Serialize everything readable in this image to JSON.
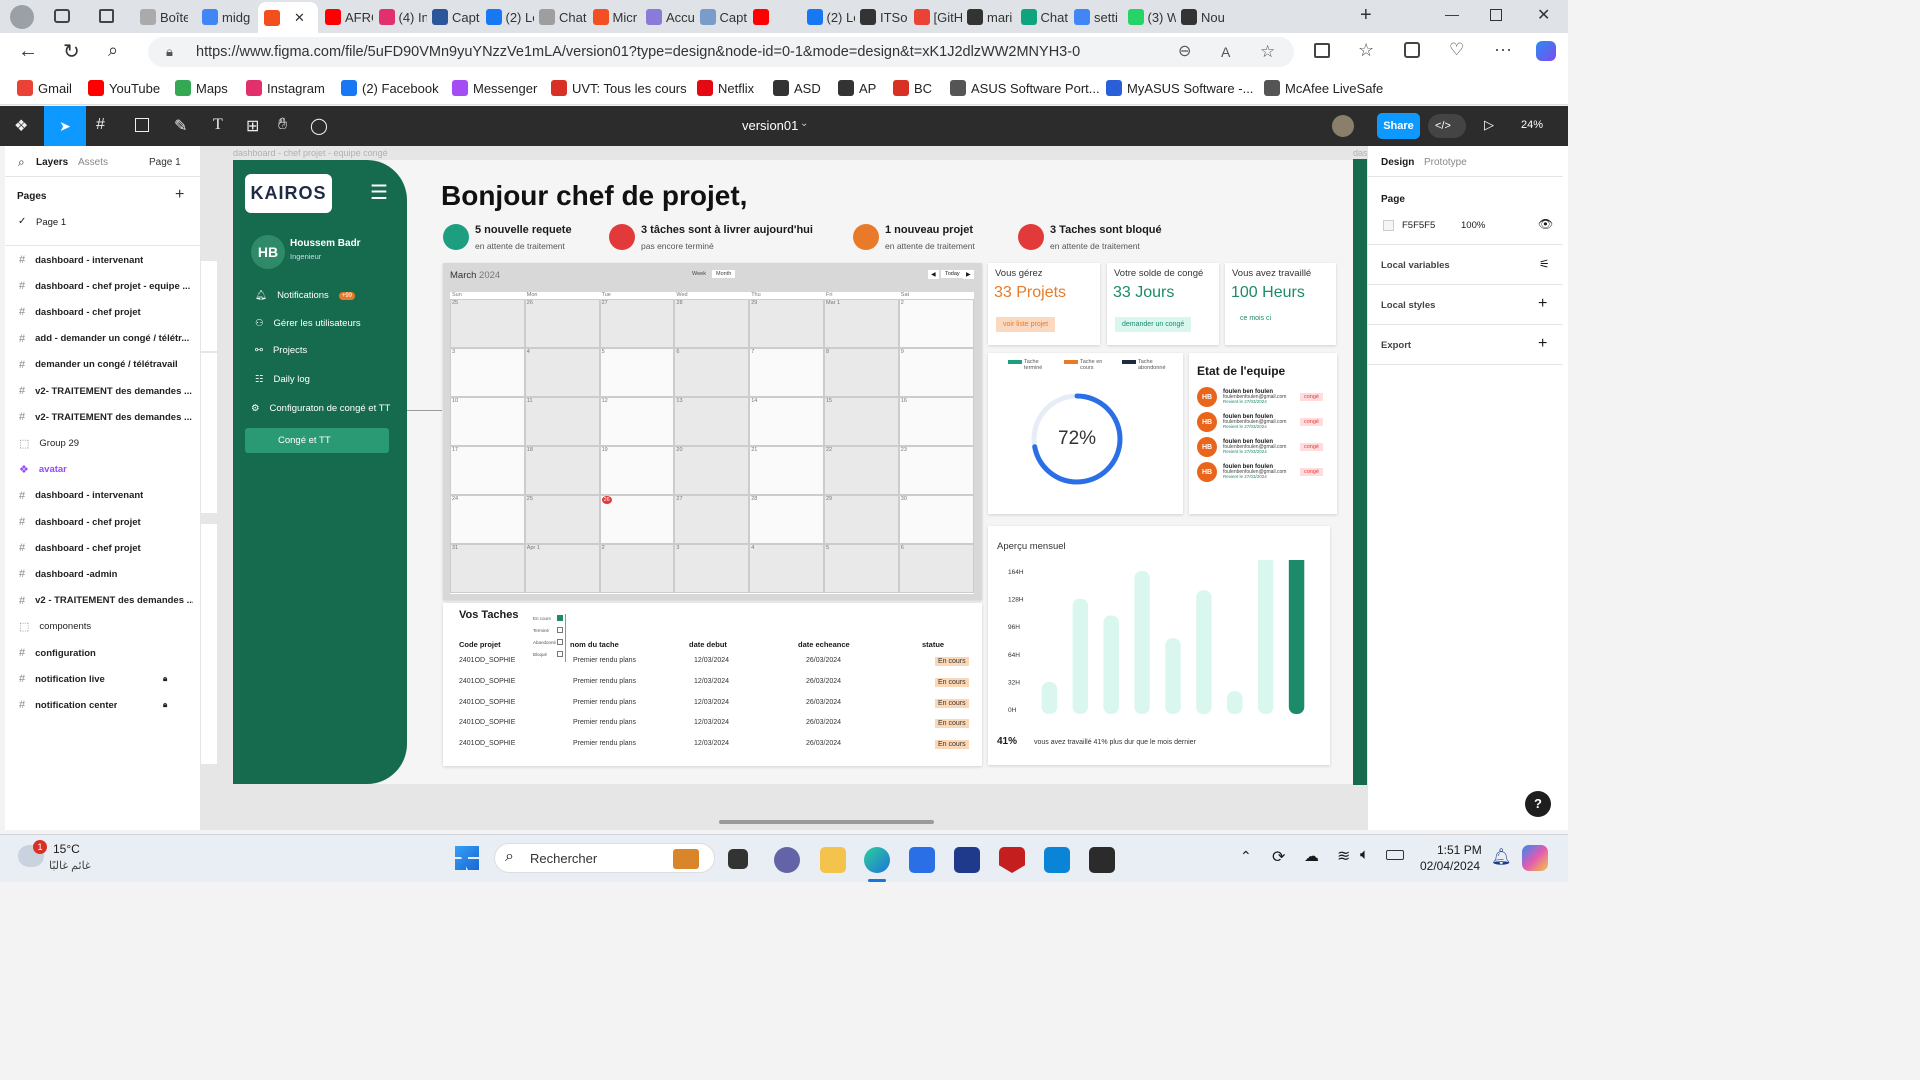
{
  "browser": {
    "tabs": [
      "Boîte",
      "midg",
      "",
      "AFRO",
      "(4) In",
      "Capt",
      "(2) Le",
      "Chat",
      "Micr",
      "Accu",
      "Capt",
      "",
      "(2) Le",
      "ITSo",
      "[GitH",
      "mari",
      "Chat",
      "setti",
      "(3) W",
      "Nou"
    ],
    "url": "https://www.figma.com/file/5uFD90VMn9yuYNzzVe1mLA/version01?type=design&node-id=0-1&mode=design&t=xK1J2dlzWW2MNYH3-0",
    "bookmarks": [
      "Gmail",
      "YouTube",
      "Maps",
      "Instagram",
      "(2) Facebook",
      "Messenger",
      "UVT: Tous les cours",
      "Netflix",
      "ASD",
      "AP",
      "BC",
      "ASUS Software Port...",
      "MyASUS Software -...",
      "McAfee LiveSafe"
    ]
  },
  "figma": {
    "file_name": "version01",
    "share_label": "Share",
    "zoom": "24%",
    "left_tabs": [
      "Layers",
      "Assets"
    ],
    "page_selector": "Page 1",
    "pages_heading": "Pages",
    "current_page": "Page 1",
    "layers": [
      "dashboard - intervenant",
      "dashboard - chef projet - equipe ...",
      "dashboard - chef projet",
      "add - demander un congé / télétr...",
      "demander un congé / télétravail",
      "v2- TRAITEMENT des demandes ...",
      "v2- TRAITEMENT des demandes ...",
      "Group 29",
      "avatar",
      "dashboard - intervenant",
      "dashboard - chef projet",
      "dashboard - chef projet",
      "dashboard -admin",
      "v2 - TRAITEMENT des demandes ...",
      "components",
      "configuration",
      "notification live",
      "notification center"
    ],
    "canvas_label": "dashboard - chef projet - equipe congé",
    "canvas_label_right": "das",
    "right_tabs": [
      "Design",
      "Prototype"
    ],
    "page_section": "Page",
    "page_color": "F5F5F5",
    "page_opacity": "100%",
    "sections": [
      "Local variables",
      "Local styles",
      "Export"
    ],
    "help": "?"
  },
  "dashboard": {
    "logo": "KAIROS",
    "user_initials": "HB",
    "user_name": "Houssem Badr",
    "user_role": "Ingenieur",
    "nav": [
      "Notifications",
      "Gérer les utilisateurs",
      "Projects",
      "Daily log",
      "Configuraton de congé et TT"
    ],
    "notif_count": "+99",
    "active_nav": "Congé et TT",
    "greeting": "Bonjour chef de projet,",
    "stats": [
      {
        "title": "5 nouvelle requete",
        "sub": "en attente de traitement",
        "color": "#1d9e7e"
      },
      {
        "title": "3 tâches sont à livrer aujourd'hui",
        "sub": "pas encore terminé",
        "color": "#e23a3a"
      },
      {
        "title": "1 nouveau projet",
        "sub": "en attente de traitement",
        "color": "#e87a2a"
      },
      {
        "title": "3 Taches sont bloqué",
        "sub": "en attente de traitement",
        "color": "#e23a3a"
      }
    ],
    "calendar": {
      "month": "March",
      "year": "2024",
      "views": [
        "Week",
        "Month"
      ],
      "today": "Today",
      "days": [
        "Sun",
        "Mon",
        "Tue",
        "Wed",
        "Thu",
        "Fri",
        "Sat"
      ],
      "cells": [
        "25",
        "26",
        "27",
        "28",
        "29",
        "Mar 1",
        "2",
        "3",
        "4",
        "5",
        "6",
        "7",
        "8",
        "9",
        "10",
        "11",
        "12",
        "13",
        "14",
        "15",
        "16",
        "17",
        "18",
        "19",
        "20",
        "21",
        "22",
        "23",
        "24",
        "25",
        "26",
        "27",
        "28",
        "29",
        "30",
        "31",
        "Apr 1",
        "2",
        "3",
        "4",
        "5",
        "6"
      ],
      "highlight": "26"
    },
    "kpis": [
      {
        "label": "Vous gérez",
        "value": "33 Projets",
        "action": "voir liste projet"
      },
      {
        "label": "Votre solde de congé",
        "value": "33 Jours",
        "action": "demander un congé"
      },
      {
        "label": "Vous avez travaillé",
        "value": "100 Heurs",
        "action": "ce mois ci"
      }
    ],
    "progress": {
      "legend": [
        "Tache terminé",
        "Tache en cours",
        "Tache abondonné"
      ],
      "legend_colors": [
        "#1d9e7e",
        "#e87a2a",
        "#1f2a44"
      ],
      "value": 72,
      "label": "72%"
    },
    "team": {
      "title": "Etat de l'equipe",
      "members": [
        {
          "initials": "HB",
          "name": "foulen ben foulen",
          "email": "foulenbenfoulen@gmail.com",
          "note": "Revient le 27/03/2024",
          "status": "congé"
        },
        {
          "initials": "HB",
          "name": "foulen ben foulen",
          "email": "foulenbenfoulen@gmail.com",
          "note": "Revient le 27/03/2024",
          "status": "congé"
        },
        {
          "initials": "HB",
          "name": "foulen ben foulen",
          "email": "foulenbenfoulen@gmail.com",
          "note": "Revient le 27/03/2024",
          "status": "congé"
        },
        {
          "initials": "HB",
          "name": "foulen ben foulen",
          "email": "foulenbenfoulen@gmail.com",
          "note": "Revient le 27/03/2024",
          "status": "congé"
        }
      ]
    },
    "tasks": {
      "title": "Vos Taches",
      "filters": [
        "En cours",
        "Terminé",
        "Abandonné",
        "Bloqué"
      ],
      "headers": [
        "Code projet",
        "nom du tache",
        "date debut",
        "date  echeance",
        "statue"
      ],
      "rows": [
        [
          "2401OD_SOPHIE",
          "Premier rendu plans",
          "12/03/2024",
          "26/03/2024",
          "En cours"
        ],
        [
          "2401OD_SOPHIE",
          "Premier rendu plans",
          "12/03/2024",
          "26/03/2024",
          "En cours"
        ],
        [
          "2401OD_SOPHIE",
          "Premier rendu plans",
          "12/03/2024",
          "26/03/2024",
          "En cours"
        ],
        [
          "2401OD_SOPHIE",
          "Premier rendu plans",
          "12/03/2024",
          "26/03/2024",
          "En cours"
        ],
        [
          "2401OD_SOPHIE",
          "Premier rendu plans",
          "12/03/2024",
          "26/03/2024",
          "En cours"
        ]
      ]
    },
    "monthly": {
      "title": "Aperçu mensuel",
      "percent": "41%",
      "caption": "vous avez travaillé 41% plus dur que le mois dernier"
    }
  },
  "chart_data": {
    "type": "bar",
    "title": "Aperçu mensuel",
    "y_ticks": [
      "164H",
      "128H",
      "96H",
      "64H",
      "32H",
      "0H"
    ],
    "ylim": [
      0,
      164
    ],
    "values": [
      38,
      137,
      117,
      170,
      90,
      147,
      27,
      188,
      203
    ],
    "highlight_index": 8,
    "colors": {
      "bar": "#d9f6ef",
      "highlight": "#1d8a6a"
    }
  },
  "taskbar": {
    "weather_temp": "15°C",
    "weather_desc": "غائم غالبًا",
    "search": "Rechercher",
    "time": "1:51 PM",
    "date": "02/04/2024"
  }
}
